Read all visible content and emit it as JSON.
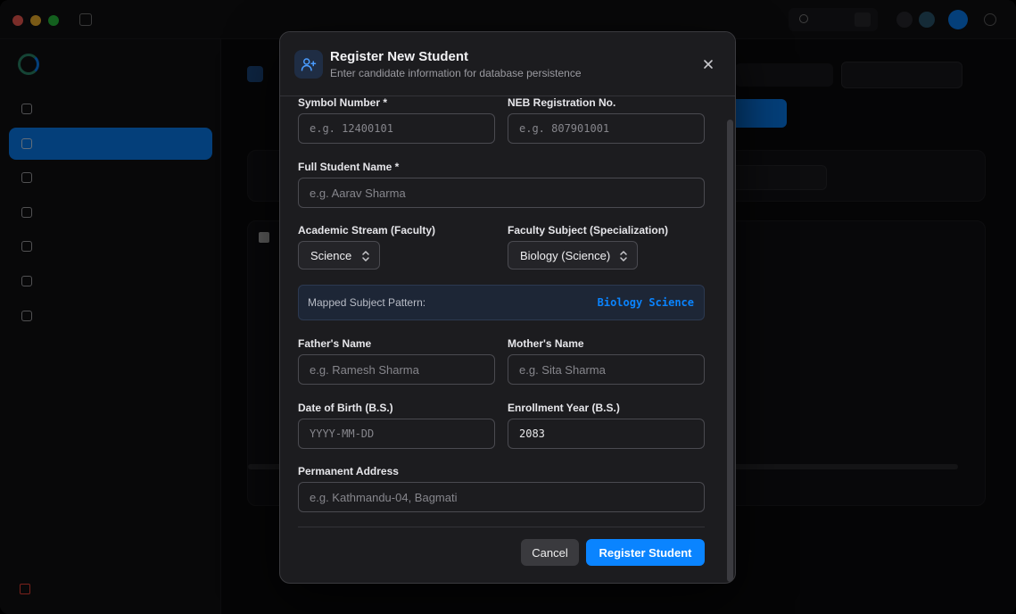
{
  "modal": {
    "title": "Register New Student",
    "subtitle": "Enter candidate information for database persistence",
    "icon": "user-plus-icon",
    "fields": {
      "symbol_number": {
        "label": "Symbol Number *",
        "placeholder": "e.g. 12400101",
        "value": ""
      },
      "neb_registration": {
        "label": "NEB Registration No.",
        "placeholder": "e.g. 807901001",
        "value": ""
      },
      "full_name": {
        "label": "Full Student Name *",
        "placeholder": "e.g. Aarav Sharma",
        "value": ""
      },
      "stream": {
        "label": "Academic Stream (Faculty)",
        "selected": "Science"
      },
      "faculty_subject": {
        "label": "Faculty Subject (Specialization)",
        "selected": "Biology (Science)"
      },
      "father_name": {
        "label": "Father's Name",
        "placeholder": "e.g. Ramesh Sharma",
        "value": ""
      },
      "mother_name": {
        "label": "Mother's Name",
        "placeholder": "e.g. Sita Sharma",
        "value": ""
      },
      "dob": {
        "label": "Date of Birth (B.S.)",
        "placeholder": "YYYY-MM-DD",
        "value": ""
      },
      "enrollment_year": {
        "label": "Enrollment Year (B.S.)",
        "placeholder": "",
        "value": "2083"
      },
      "address": {
        "label": "Permanent Address",
        "placeholder": "e.g. Kathmandu-04, Bagmati",
        "value": ""
      }
    },
    "pattern": {
      "label": "Mapped Subject Pattern:",
      "value": "Biology Science"
    },
    "buttons": {
      "cancel": "Cancel",
      "submit": "Register Student"
    }
  },
  "colors": {
    "accent": "#0a84ff",
    "modal_bg": "#1c1c1f",
    "danger": "#ff453a"
  }
}
